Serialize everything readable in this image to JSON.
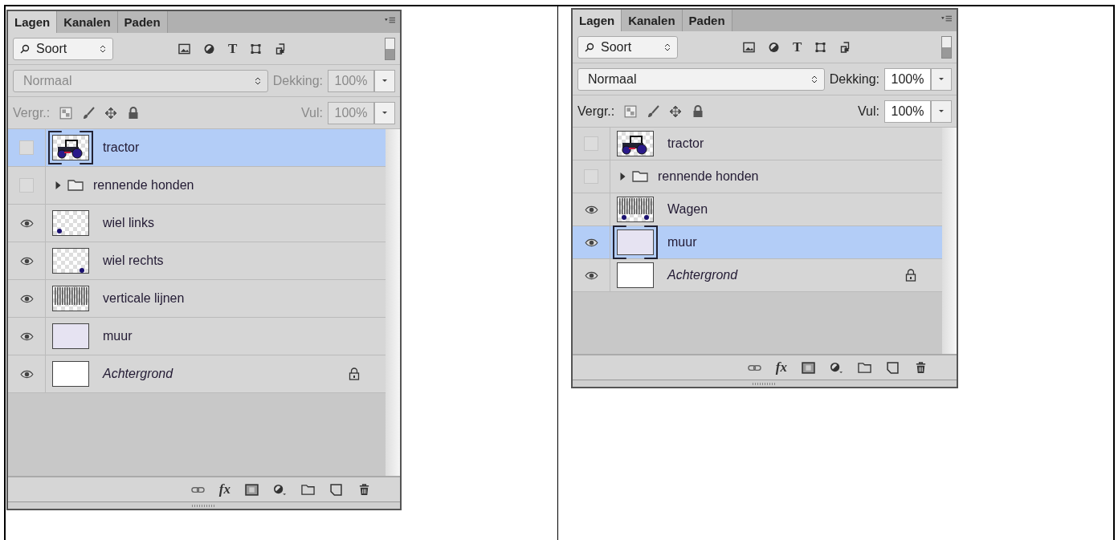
{
  "panels": [
    {
      "tabs": [
        {
          "label": "Lagen",
          "selected": true
        },
        {
          "label": "Kanalen",
          "selected": false
        },
        {
          "label": "Paden",
          "selected": false
        }
      ],
      "filter": {
        "value": "Soort",
        "type_glyph": "T"
      },
      "options_disabled": true,
      "blend_mode": {
        "value": "Normaal"
      },
      "opacity": {
        "label": "Dekking:",
        "value": "100%"
      },
      "lock": {
        "label": "Vergr.:"
      },
      "fill": {
        "label": "Vul:",
        "value": "100%"
      },
      "layers": [
        {
          "name": "tractor",
          "kind": "layer",
          "thumbnail": {
            "kind": "tractor"
          },
          "visible": false,
          "selected": true
        },
        {
          "name": "rennende honden",
          "kind": "group",
          "visible": false,
          "selected": false
        },
        {
          "name": "wiel links",
          "kind": "layer",
          "thumbnail": {
            "kind": "dot-left"
          },
          "visible": true,
          "selected": false
        },
        {
          "name": "wiel rechts",
          "kind": "layer",
          "thumbnail": {
            "kind": "dot-right"
          },
          "visible": true,
          "selected": false
        },
        {
          "name": "verticale lijnen",
          "kind": "layer",
          "thumbnail": {
            "kind": "stripes"
          },
          "visible": true,
          "selected": false
        },
        {
          "name": "muur",
          "kind": "layer",
          "thumbnail": {
            "kind": "wall"
          },
          "visible": true,
          "selected": false
        },
        {
          "name": "Achtergrond",
          "kind": "background",
          "thumbnail": {
            "kind": "white"
          },
          "visible": true,
          "selected": false
        }
      ],
      "footer": {
        "effects_glyph": "fx"
      }
    },
    {
      "tabs": [
        {
          "label": "Lagen",
          "selected": true
        },
        {
          "label": "Kanalen",
          "selected": false
        },
        {
          "label": "Paden",
          "selected": false
        }
      ],
      "filter": {
        "value": "Soort",
        "type_glyph": "T"
      },
      "options_disabled": false,
      "blend_mode": {
        "value": "Normaal"
      },
      "opacity": {
        "label": "Dekking:",
        "value": "100%"
      },
      "lock": {
        "label": "Vergr.:"
      },
      "fill": {
        "label": "Vul:",
        "value": "100%"
      },
      "layers": [
        {
          "name": "tractor",
          "kind": "layer",
          "thumbnail": {
            "kind": "tractor"
          },
          "visible": false,
          "selected": false
        },
        {
          "name": "rennende honden",
          "kind": "group",
          "visible": false,
          "selected": false
        },
        {
          "name": "Wagen",
          "kind": "layer",
          "thumbnail": {
            "kind": "wagon"
          },
          "visible": true,
          "selected": false
        },
        {
          "name": "muur",
          "kind": "layer",
          "thumbnail": {
            "kind": "wall"
          },
          "visible": true,
          "selected": true
        },
        {
          "name": "Achtergrond",
          "kind": "background",
          "thumbnail": {
            "kind": "white"
          },
          "visible": true,
          "selected": false
        }
      ],
      "footer": {
        "effects_glyph": "fx"
      }
    }
  ]
}
